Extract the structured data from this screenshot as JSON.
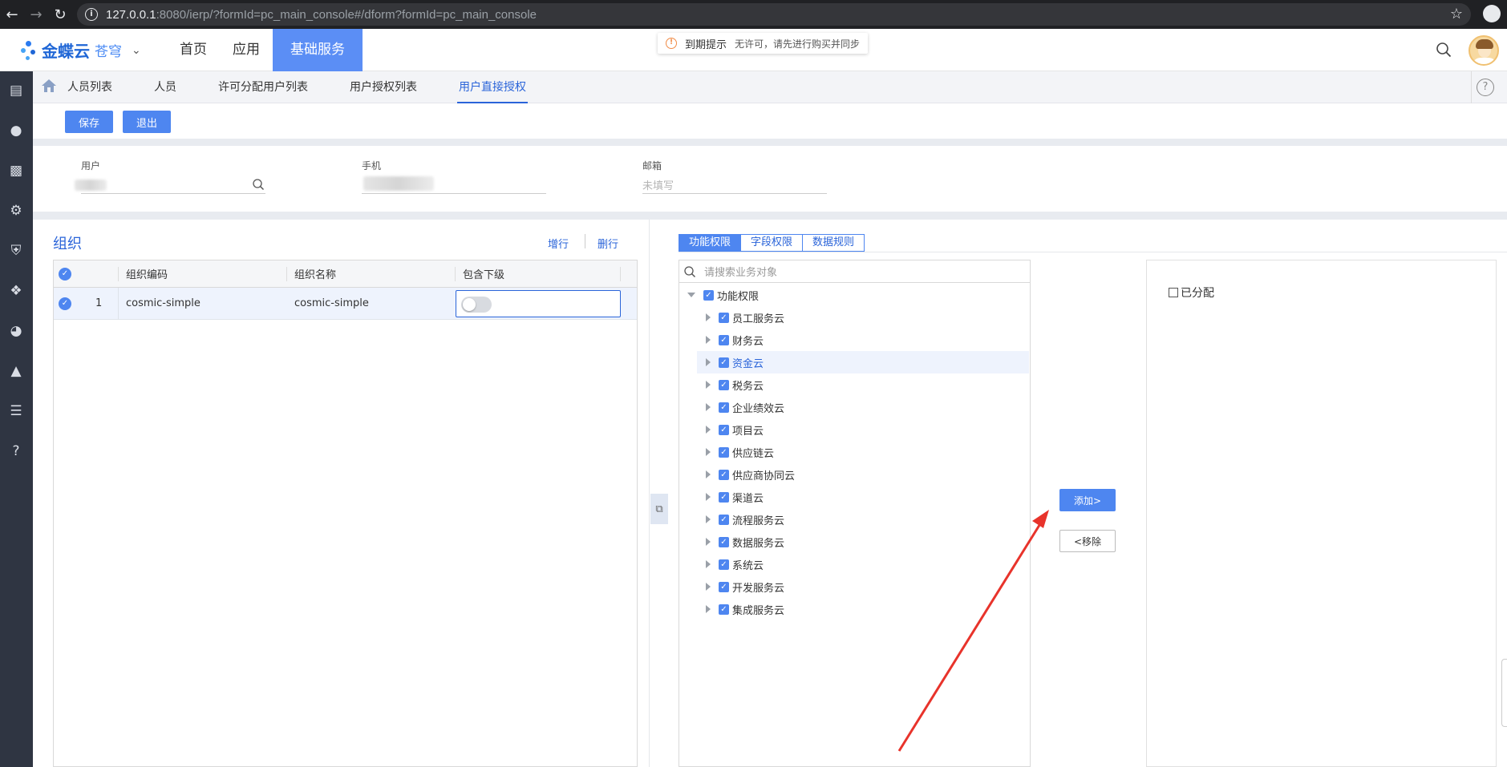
{
  "browser": {
    "url_host": "127.0.0.1",
    "url_rest": ":8080/ierp/?formId=pc_main_console#/dform?formId=pc_main_console"
  },
  "header": {
    "logo_text": "金蝶云",
    "logo_sub": "苍穹",
    "nav": [
      "首页",
      "应用",
      "基础服务"
    ],
    "notice_title": "到期提示",
    "notice_msg": "无许可，请先进行购买并同步"
  },
  "tabs": [
    "人员列表",
    "人员",
    "许可分配用户列表",
    "用户授权列表",
    "用户直接授权"
  ],
  "toolbar": {
    "save_label": "保存",
    "exit_label": "退出"
  },
  "user_fields": {
    "user_label": "用户",
    "phone_label": "手机",
    "email_label": "邮箱",
    "email_placeholder": "未填写"
  },
  "org": {
    "title": "组织",
    "add_row": "增行",
    "delete_row": "删行",
    "columns": [
      "组织编码",
      "组织名称",
      "包含下级"
    ],
    "rows": [
      {
        "index": "1",
        "code": "cosmic-simple",
        "name": "cosmic-simple"
      }
    ]
  },
  "perm": {
    "tabs": [
      "功能权限",
      "字段权限",
      "数据规则"
    ],
    "search_placeholder": "请搜索业务对象",
    "root": "功能权限",
    "items": [
      "员工服务云",
      "财务云",
      "资金云",
      "税务云",
      "企业绩效云",
      "项目云",
      "供应链云",
      "供应商协同云",
      "渠道云",
      "流程服务云",
      "数据服务云",
      "系统云",
      "开发服务云",
      "集成服务云"
    ],
    "add_label": "添加>",
    "remove_label": "<移除",
    "assigned_label": "已分配"
  },
  "colors": {
    "accent": "#4e86f0",
    "sidebar": "#2f3542",
    "arrow": "#e8332b"
  }
}
